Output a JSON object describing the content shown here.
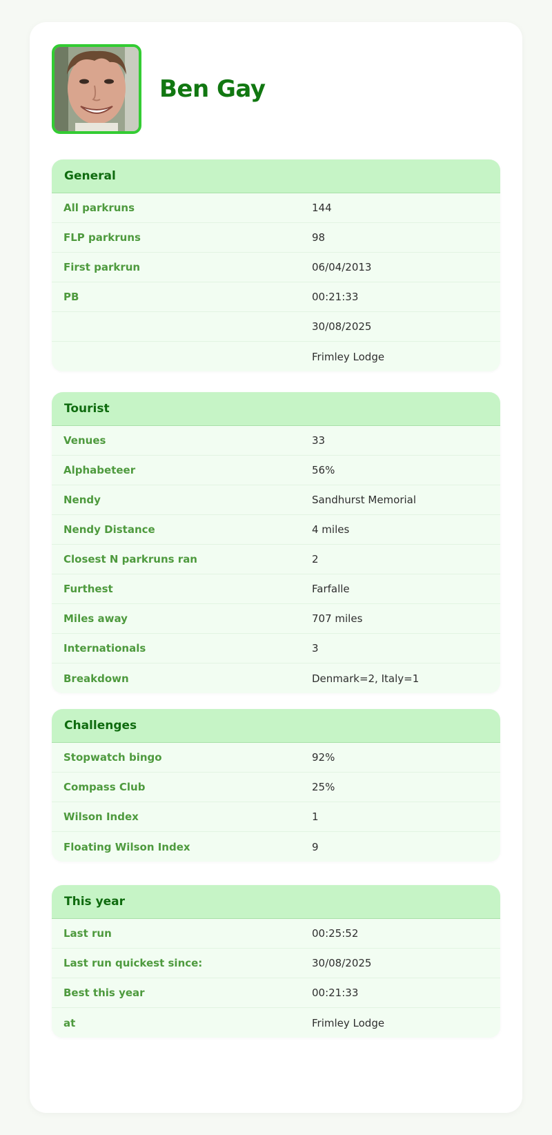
{
  "profile": {
    "name": "Ben Gay",
    "avatar_icon": "person-photo"
  },
  "colors": {
    "accent": "#33cc33",
    "title_green": "#117711",
    "header_bg": "#c6f4c6",
    "label_green": "#4e9a3e"
  },
  "sections": [
    {
      "title": "General",
      "rows": [
        {
          "label": "All parkruns",
          "value": "144"
        },
        {
          "label": "FLP parkruns",
          "value": "98"
        },
        {
          "label": "First parkrun",
          "value": "06/04/2013"
        },
        {
          "label": "PB",
          "value": "00:21:33"
        },
        {
          "label": "",
          "value": "30/08/2025"
        },
        {
          "label": "",
          "value": "Frimley Lodge"
        }
      ]
    },
    {
      "title": "Tourist",
      "rows": [
        {
          "label": "Venues",
          "value": "33"
        },
        {
          "label": "Alphabeteer",
          "value": "56%"
        },
        {
          "label": "Nendy",
          "value": "Sandhurst Memorial"
        },
        {
          "label": "Nendy Distance",
          "value": "4 miles"
        },
        {
          "label": "Closest N parkruns ran",
          "value": "2"
        },
        {
          "label": "Furthest",
          "value": "Farfalle"
        },
        {
          "label": "Miles away",
          "value": "707 miles"
        },
        {
          "label": "Internationals",
          "value": "3"
        },
        {
          "label": "Breakdown",
          "value": "Denmark=2, Italy=1"
        }
      ]
    },
    {
      "title": "Challenges",
      "rows": [
        {
          "label": "Stopwatch bingo",
          "value": "92%"
        },
        {
          "label": "Compass Club",
          "value": "25%"
        },
        {
          "label": "Wilson Index",
          "value": "1"
        },
        {
          "label": "Floating Wilson Index",
          "value": "9"
        }
      ]
    },
    {
      "title": "This year",
      "rows": [
        {
          "label": "Last run",
          "value": "00:25:52"
        },
        {
          "label": "Last run quickest since:",
          "value": "30/08/2025"
        },
        {
          "label": "Best this year",
          "value": "00:21:33"
        },
        {
          "label": "at",
          "value": "Frimley Lodge"
        }
      ]
    }
  ]
}
